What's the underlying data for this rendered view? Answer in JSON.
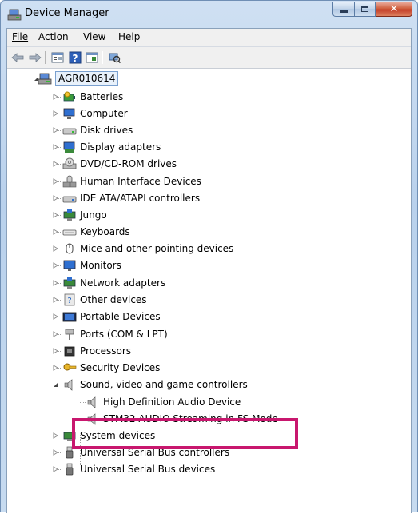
{
  "window": {
    "title": "Device Manager",
    "colors": {
      "frame": "#b9d1ec",
      "close_button": "#c4402a",
      "highlight_box": "#c8176e"
    }
  },
  "menu": [
    {
      "label": "File",
      "icon": ""
    },
    {
      "label": "Action"
    },
    {
      "label": "View"
    },
    {
      "label": "Help"
    }
  ],
  "toolbar": {
    "buttons": [
      "back-arrow-icon",
      "forward-arrow-icon",
      "properties-icon",
      "help-icon",
      "update-driver-icon",
      "scan-hardware-icon"
    ]
  },
  "tree": {
    "root": "AGR010614",
    "categories": [
      {
        "label": "Batteries",
        "icon": "battery-icon"
      },
      {
        "label": "Computer",
        "icon": "computer-icon"
      },
      {
        "label": "Disk drives",
        "icon": "disk-drive-icon"
      },
      {
        "label": "Display adapters",
        "icon": "display-adapter-icon"
      },
      {
        "label": "DVD/CD-ROM drives",
        "icon": "dvd-drive-icon"
      },
      {
        "label": "Human Interface Devices",
        "icon": "hid-icon"
      },
      {
        "label": "IDE ATA/ATAPI controllers",
        "icon": "ide-controller-icon"
      },
      {
        "label": "Jungo",
        "icon": "jungo-icon"
      },
      {
        "label": "Keyboards",
        "icon": "keyboard-icon"
      },
      {
        "label": "Mice and other pointing devices",
        "icon": "mouse-icon"
      },
      {
        "label": "Monitors",
        "icon": "monitor-icon"
      },
      {
        "label": "Network adapters",
        "icon": "network-adapter-icon"
      },
      {
        "label": "Other devices",
        "icon": "unknown-device-icon"
      },
      {
        "label": "Portable Devices",
        "icon": "portable-device-icon"
      },
      {
        "label": "Ports (COM & LPT)",
        "icon": "port-icon"
      },
      {
        "label": "Processors",
        "icon": "processor-icon"
      },
      {
        "label": "Security Devices",
        "icon": "security-device-icon"
      },
      {
        "label": "Sound, video and game controllers",
        "icon": "speaker-icon",
        "expanded": true
      },
      {
        "label": "High Definition Audio Device",
        "icon": "speaker-icon",
        "child": true
      },
      {
        "label": "STM32 AUDIO Streaming in FS Mode",
        "icon": "speaker-icon",
        "child": true
      },
      {
        "label": "System devices",
        "icon": "system-device-icon"
      },
      {
        "label": "Universal Serial Bus controllers",
        "icon": "usb-icon"
      },
      {
        "label": "Universal Serial Bus devices",
        "icon": "usb-icon"
      }
    ]
  }
}
